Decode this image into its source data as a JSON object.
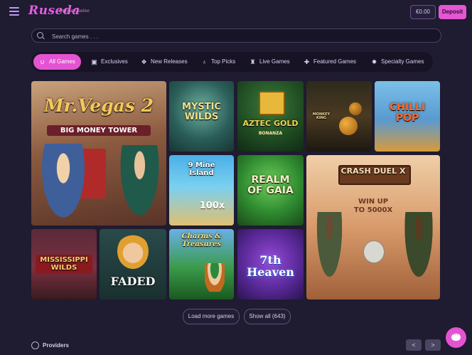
{
  "header": {
    "logo_text": "Ruseda",
    "logo_sub": "Online Casino",
    "balance": "€0.00",
    "deposit_label": "Deposit",
    "menu_icon": "hamburger-icon"
  },
  "search": {
    "placeholder": "Search games . . ."
  },
  "categories": [
    {
      "label": "All Games",
      "icon": "horseshoe-icon",
      "active": true
    },
    {
      "label": "Exclusives",
      "icon": "exclusive-icon",
      "active": false
    },
    {
      "label": "New Releases",
      "icon": "new-icon",
      "active": false
    },
    {
      "label": "Top Picks",
      "icon": "badge-icon",
      "active": false
    },
    {
      "label": "Live Games",
      "icon": "live-dealer-icon",
      "active": false
    },
    {
      "label": "Featured Games",
      "icon": "puzzle-icon",
      "active": false
    },
    {
      "label": "Specialty Games",
      "icon": "gear-icon",
      "active": false
    }
  ],
  "games": [
    {
      "title": "Mr.Vegas 2",
      "subtitle": "BIG MONEY TOWER"
    },
    {
      "title": "MYSTIC WILDS",
      "subtitle": ""
    },
    {
      "title": "AZTEC GOLD",
      "subtitle": "BONANZA"
    },
    {
      "title": "MONKEY KING",
      "subtitle": ""
    },
    {
      "title": "CHILLI POP",
      "subtitle": ""
    },
    {
      "title": "9 Mine Island",
      "subtitle": "100x"
    },
    {
      "title": "REALM OF GAIA",
      "subtitle": ""
    },
    {
      "title": "CRASH DUEL X",
      "subtitle": "WIN UP TO 5000X"
    },
    {
      "title": "MISSISSIPPI WILDS",
      "subtitle": ""
    },
    {
      "title": "FADED",
      "subtitle": ""
    },
    {
      "title": "Charms & Treasures",
      "subtitle": ""
    },
    {
      "title": "7th Heaven",
      "subtitle": ""
    }
  ],
  "load_more_label": "Load more games",
  "show_all_label": "Show all (643)",
  "providers_label": "Providers",
  "pager": {
    "prev": "<",
    "next": ">"
  },
  "colors": {
    "accent": "#e454d2",
    "background": "#1f1b30"
  }
}
